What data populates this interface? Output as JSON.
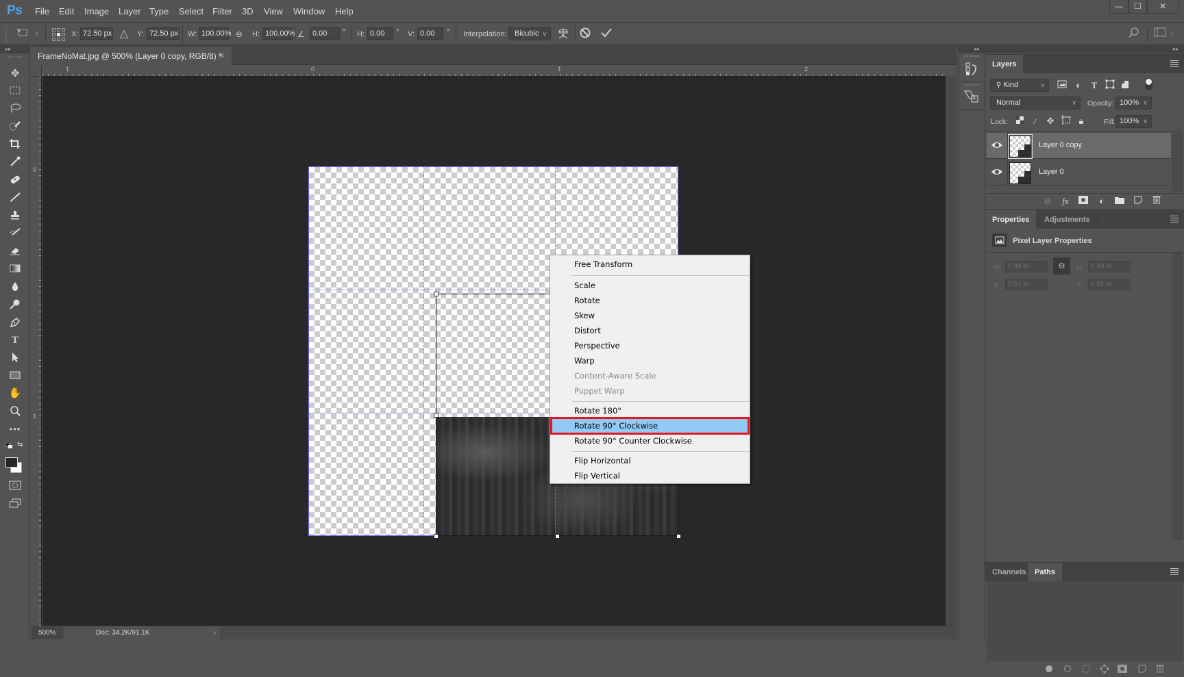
{
  "app": {
    "logo": "Ps",
    "menu": [
      "File",
      "Edit",
      "Image",
      "Layer",
      "Type",
      "Select",
      "Filter",
      "3D",
      "View",
      "Window",
      "Help"
    ],
    "window_controls": {
      "minimize": "—",
      "maximize": "☐",
      "close": "✕"
    }
  },
  "options_bar": {
    "x_label": "X:",
    "x_value": "72.50 px",
    "y_label": "Y:",
    "y_value": "72.50 px",
    "w_label": "W:",
    "w_value": "100.00%",
    "h_label": "H:",
    "h_value": "100.00%",
    "angle_value": "0.00",
    "angle_unit": "°",
    "hskew_label": "H:",
    "hskew_value": "0.00",
    "hskew_unit": "°",
    "vskew_label": "V:",
    "vskew_value": "0.00",
    "vskew_unit": "°",
    "interpolation_label": "Interpolation:",
    "interpolation_value": "Bicubic",
    "cancel_icon": "cancel-transform-icon",
    "commit_icon": "commit-transform-icon"
  },
  "document": {
    "tab_title": "FrameNoMat.jpg @ 500% (Layer 0 copy, RGB/8) *",
    "tab_close": "✕",
    "zoom": "500%",
    "doc_info": "Doc: 34.2K/91.1K",
    "doc_info_arrow": "›"
  },
  "rulers": {
    "horizontal_labels": [
      "1",
      "0",
      "1",
      "2"
    ],
    "vertical_labels": [
      "0",
      "1"
    ]
  },
  "context_menu": {
    "groups": [
      [
        {
          "label": "Free Transform",
          "enabled": true
        }
      ],
      [
        {
          "label": "Scale",
          "enabled": true
        },
        {
          "label": "Rotate",
          "enabled": true
        },
        {
          "label": "Skew",
          "enabled": true
        },
        {
          "label": "Distort",
          "enabled": true
        },
        {
          "label": "Perspective",
          "enabled": true
        },
        {
          "label": "Warp",
          "enabled": true
        },
        {
          "label": "Content-Aware Scale",
          "enabled": false
        },
        {
          "label": "Puppet Warp",
          "enabled": false
        }
      ],
      [
        {
          "label": "Rotate 180°",
          "enabled": true
        },
        {
          "label": "Rotate 90° Clockwise",
          "enabled": true,
          "highlighted": true
        },
        {
          "label": "Rotate 90° Counter Clockwise",
          "enabled": true
        }
      ],
      [
        {
          "label": "Flip Horizontal",
          "enabled": true
        },
        {
          "label": "Flip Vertical",
          "enabled": true
        }
      ]
    ],
    "highlight_color": "#91c9f7",
    "annotation_color": "#e8141e"
  },
  "layers_panel": {
    "tab": "Layers",
    "filter_kind": "Kind",
    "blend_mode": "Normal",
    "opacity_label": "Opacity:",
    "opacity_value": "100%",
    "lock_label": "Lock:",
    "fill_label": "Fill:",
    "fill_value": "100%",
    "layers": [
      {
        "name": "Layer 0 copy",
        "visible": true,
        "selected": true
      },
      {
        "name": "Layer 0",
        "visible": true,
        "selected": false
      }
    ]
  },
  "properties_panel": {
    "tabs": [
      "Properties",
      "Adjustments"
    ],
    "active_tab": "Properties",
    "title": "Pixel Layer Properties",
    "w_label": "W:",
    "w_value": "0.99 in",
    "h_label": "H:",
    "h_value": "0.99 in",
    "x_label": "X:",
    "x_value": "0.51 in",
    "y_label": "Y:",
    "y_value": "0.51 in"
  },
  "paths_panel": {
    "tabs": [
      "Channels",
      "Paths"
    ],
    "active_tab": "Paths"
  }
}
